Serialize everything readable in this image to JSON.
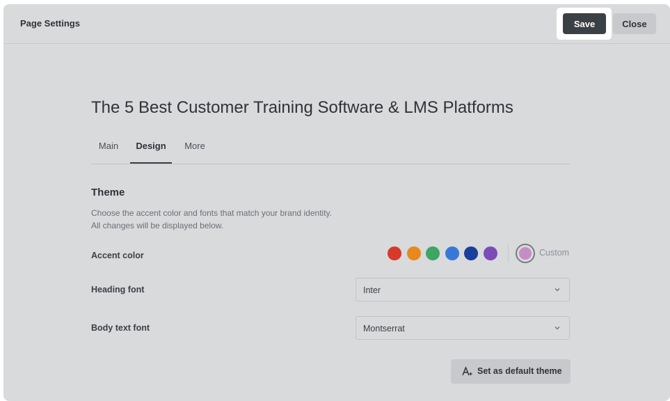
{
  "header": {
    "title": "Page Settings",
    "save_label": "Save",
    "close_label": "Close"
  },
  "page": {
    "title": "The 5 Best Customer Training Software & LMS Platforms"
  },
  "tabs": [
    {
      "label": "Main",
      "active": false
    },
    {
      "label": "Design",
      "active": true
    },
    {
      "label": "More",
      "active": false
    }
  ],
  "theme": {
    "title": "Theme",
    "description_line1": "Choose the accent color and fonts that match your brand identity.",
    "description_line2": "All changes will be displayed below.",
    "accent_label": "Accent color",
    "accent_colors": [
      "#d8392b",
      "#e8891c",
      "#3ea564",
      "#3a78d8",
      "#1a3e9c",
      "#7d4bb8"
    ],
    "custom_label": "Custom",
    "custom_color": "#c48ec4",
    "heading_font_label": "Heading font",
    "heading_font_value": "Inter",
    "body_font_label": "Body text font",
    "body_font_value": "Montserrat",
    "default_button_label": "Set as default theme"
  }
}
